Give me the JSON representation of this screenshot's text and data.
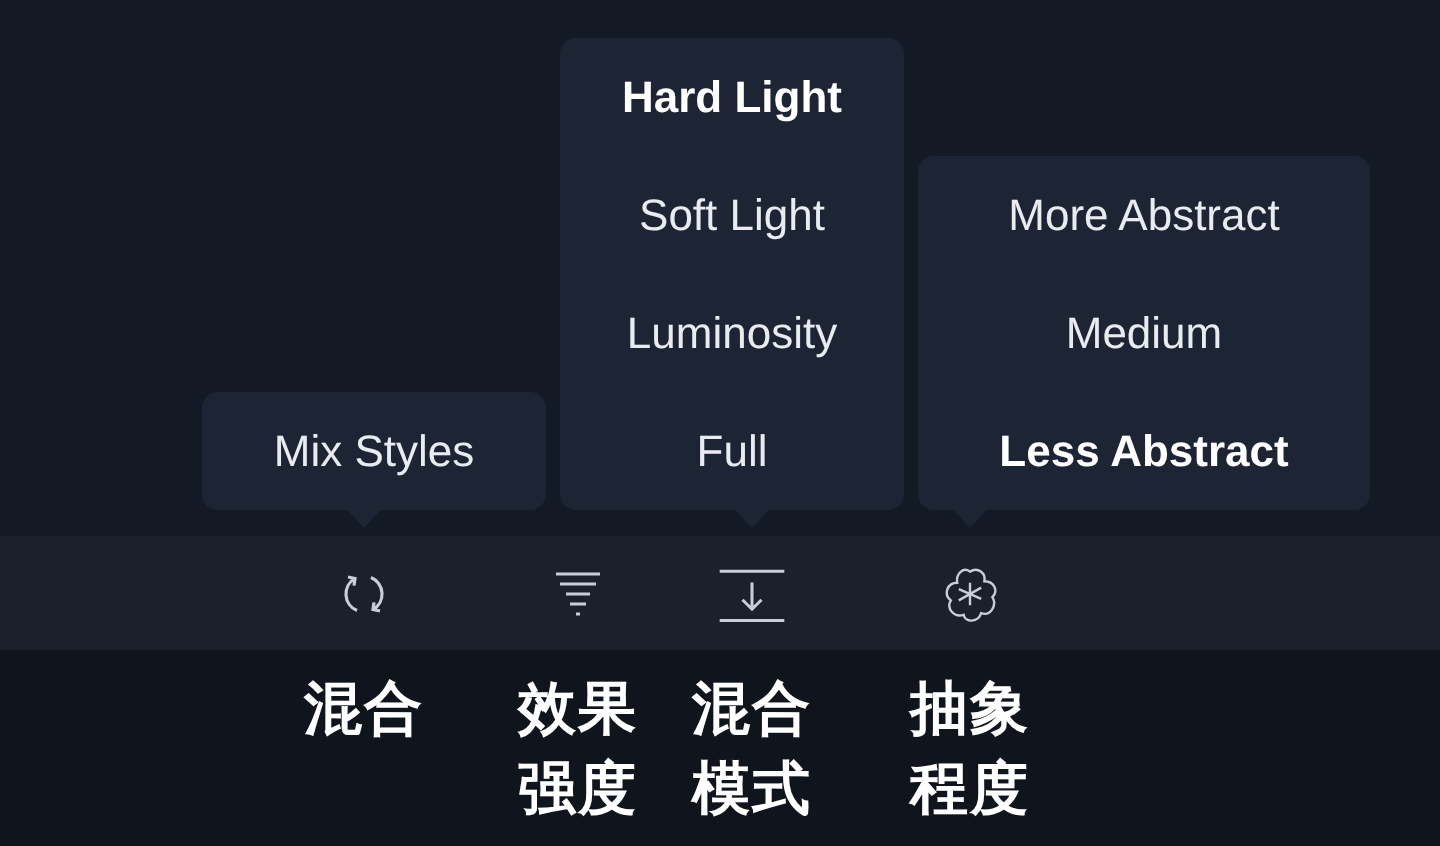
{
  "tools": [
    {
      "label_lines": [
        "混合"
      ],
      "popup": [
        {
          "label": "Mix Styles",
          "selected": false
        }
      ]
    },
    {
      "label_lines": [
        "效果",
        "强度"
      ]
    },
    {
      "label_lines": [
        "混合",
        "模式"
      ],
      "popup": [
        {
          "label": "Hard Light",
          "selected": true
        },
        {
          "label": "Soft Light",
          "selected": false
        },
        {
          "label": "Luminosity",
          "selected": false
        },
        {
          "label": "Full",
          "selected": false
        }
      ]
    },
    {
      "label_lines": [
        "抽象",
        "程度"
      ],
      "popup": [
        {
          "label": "More Abstract",
          "selected": false
        },
        {
          "label": "Medium",
          "selected": false
        },
        {
          "label": "Less Abstract",
          "selected": true
        }
      ]
    }
  ]
}
